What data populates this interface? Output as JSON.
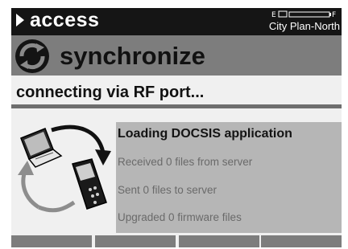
{
  "header": {
    "title": "access",
    "profile": "City Plan-North",
    "battery_icon": "battery-icon"
  },
  "screen": {
    "title": "synchronize",
    "icon": "sync-arrows-icon"
  },
  "status": {
    "message": "connecting via RF port..."
  },
  "progress": {
    "heading": "Loading DOCSIS application",
    "received": "Received 0 files from server",
    "sent": "Sent 0 files to server",
    "upgraded": "Upgraded 0 firmware files"
  },
  "illustration": {
    "icons": [
      "laptop-icon",
      "handheld-meter-icon",
      "sync-arrows-icon"
    ]
  },
  "softkeys": [
    {
      "label": ""
    },
    {
      "label": ""
    },
    {
      "label": ""
    },
    {
      "label": ""
    }
  ],
  "colors": {
    "topbar": "#151515",
    "title_bar": "#7d7d7d",
    "panel": "#b6b6b6",
    "background": "#f0f0f0"
  }
}
